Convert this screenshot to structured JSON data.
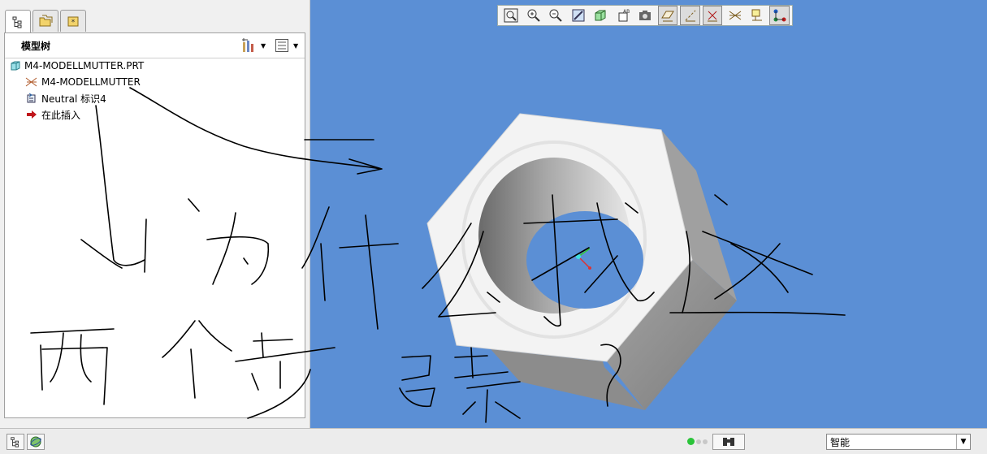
{
  "tabs": [
    {
      "icon": "model-tree-tab-icon"
    },
    {
      "icon": "folder-browser-tab-icon"
    },
    {
      "icon": "favorites-tab-icon"
    }
  ],
  "tree": {
    "title": "模型树",
    "items": [
      {
        "label": "M4-MODELLMUTTER.PRT",
        "icon": "part-icon"
      },
      {
        "label": "M4-MODELLMUTTER",
        "icon": "coordinate-system-icon"
      },
      {
        "label": "Neutral 标识4",
        "icon": "annotation-feature-icon"
      },
      {
        "label": "在此插入",
        "icon": "insert-here-arrow-icon"
      }
    ]
  },
  "toolbar": {
    "buttons": [
      {
        "icon": "refit-zoom-icon"
      },
      {
        "icon": "zoom-in-icon"
      },
      {
        "icon": "zoom-out-icon"
      },
      {
        "icon": "repaint-icon"
      },
      {
        "icon": "saved-view-icon"
      },
      {
        "icon": "display-style-icon"
      },
      {
        "icon": "view-manager-icon"
      },
      {
        "icon": "datum-plane-display-icon",
        "pressed": true
      },
      {
        "icon": "datum-axis-display-icon",
        "pressed": true
      },
      {
        "icon": "datum-point-display-icon",
        "pressed": true
      },
      {
        "icon": "coordinate-system-display-icon"
      },
      {
        "icon": "annotation-display-icon"
      },
      {
        "icon": "spin-center-icon",
        "pressed": true
      }
    ]
  },
  "status": {
    "filter_value": "智能"
  },
  "colors": {
    "viewport_bg": "#5b8fd5",
    "nut_light": "#f2f2f2",
    "nut_dark": "#8e8e8e"
  }
}
